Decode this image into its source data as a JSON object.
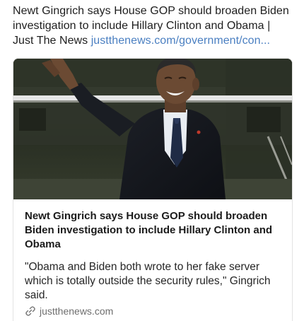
{
  "post": {
    "text": "Newt Gingrich says House GOP should broaden Biden investigation to include Hillary Clinton and Obama | Just The News",
    "link_text": "justthenews.com/government/con..."
  },
  "link_card": {
    "title": "Newt Gingrich says House GOP should broaden Biden investigation to include Hillary Clinton and Obama",
    "description": "\"Obama and Biden both wrote to her fake server which is totally outside the security rules,\" Gingrich said.",
    "domain": "justthenews.com",
    "domain_icon": "link-icon"
  },
  "colors": {
    "link": "#4a7fc1",
    "domain_text": "#6e6e6e",
    "card_border": "#e3e3e3"
  }
}
